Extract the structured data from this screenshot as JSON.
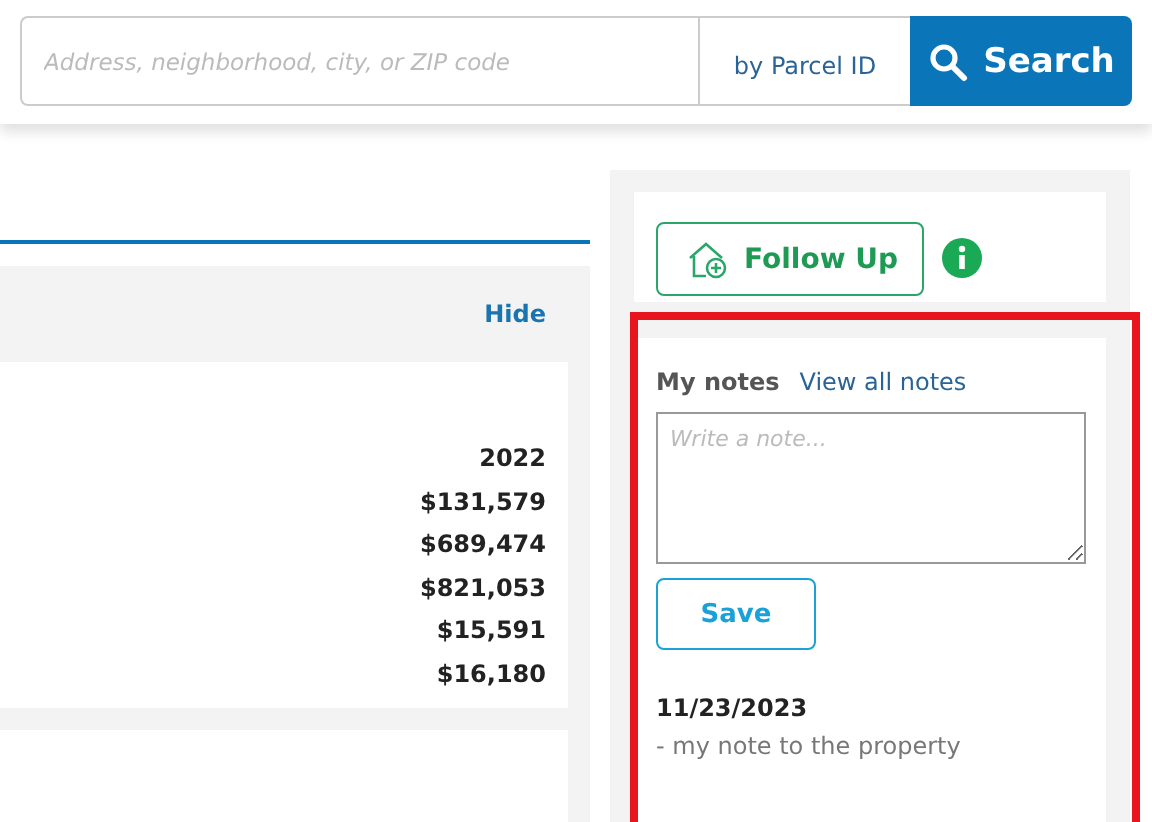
{
  "search": {
    "placeholder": "Address, neighborhood, city, or ZIP code",
    "parcel_link": "by Parcel ID",
    "button": "Search"
  },
  "section": {
    "hide_link": "Hide",
    "values": [
      "2022",
      "$131,579",
      "$689,474",
      "$821,053",
      "$15,591",
      "$16,180"
    ]
  },
  "follow_up": {
    "button": "Follow Up"
  },
  "notes": {
    "highlighted": true,
    "title": "My notes",
    "view_all_link": "View all notes",
    "placeholder": "Write a note...",
    "save_button": "Save",
    "entries": [
      {
        "date": "11/23/2023",
        "text": "- my note to the property"
      }
    ]
  }
}
